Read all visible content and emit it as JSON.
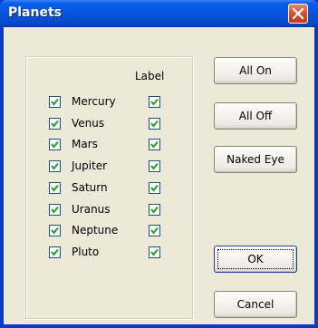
{
  "window": {
    "title": "Planets"
  },
  "list": {
    "column_header": "Label",
    "planets": [
      {
        "name": "Mercury",
        "checked": true,
        "label_checked": true
      },
      {
        "name": "Venus",
        "checked": true,
        "label_checked": true
      },
      {
        "name": "Mars",
        "checked": true,
        "label_checked": true
      },
      {
        "name": "Jupiter",
        "checked": true,
        "label_checked": true
      },
      {
        "name": "Saturn",
        "checked": true,
        "label_checked": true
      },
      {
        "name": "Uranus",
        "checked": true,
        "label_checked": true
      },
      {
        "name": "Neptune",
        "checked": true,
        "label_checked": true
      },
      {
        "name": "Pluto",
        "checked": true,
        "label_checked": true
      }
    ]
  },
  "buttons": {
    "all_on": "All On",
    "all_off": "All Off",
    "naked_eye": "Naked Eye",
    "ok": "OK",
    "cancel": "Cancel"
  },
  "colors": {
    "titlebar": "#0754dc",
    "close": "#d24a24",
    "face": "#ece9d8"
  }
}
